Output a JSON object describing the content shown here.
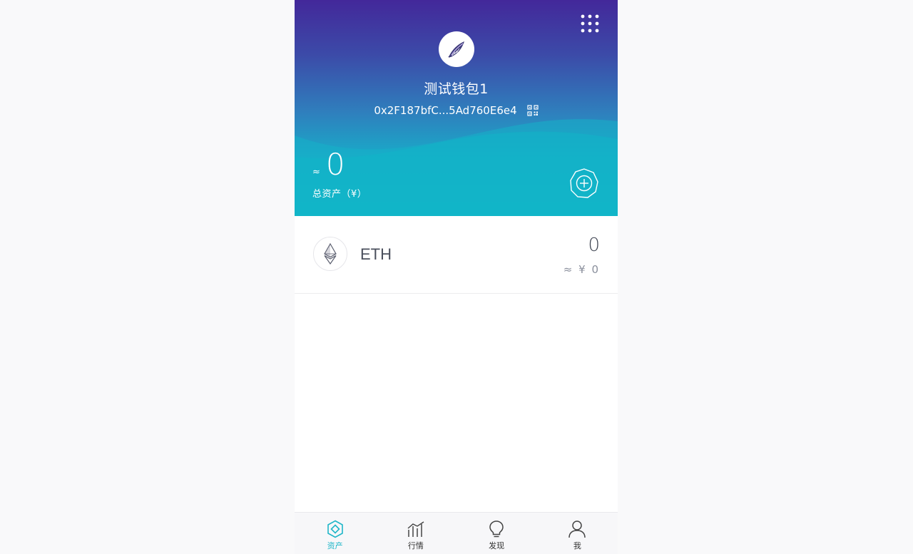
{
  "colors": {
    "accent": "#1fb6c8",
    "header_top": "#43289a",
    "header_bottom": "#0fbcc9"
  },
  "header": {
    "menu_icon": "grid-menu-icon",
    "avatar_icon": "seashell-avatar-icon",
    "wallet_name": "测试钱包1",
    "address": "0x2F187bfC...5Ad760E6e4",
    "qr_icon": "qr-code-icon",
    "total_approx": "≈",
    "total_value": "0",
    "total_label": "总资产（¥）",
    "add_icon": "add-asset-icon"
  },
  "tokens": [
    {
      "icon": "ethereum-icon",
      "symbol": "ETH",
      "amount": "0",
      "fiat": "≈ ¥ 0"
    }
  ],
  "tabbar": {
    "items": [
      {
        "label": "资产",
        "icon": "assets-icon",
        "active": true
      },
      {
        "label": "行情",
        "icon": "market-chart-icon",
        "active": false
      },
      {
        "label": "发现",
        "icon": "discover-bulb-icon",
        "active": false
      },
      {
        "label": "我",
        "icon": "profile-icon",
        "active": false
      }
    ]
  }
}
